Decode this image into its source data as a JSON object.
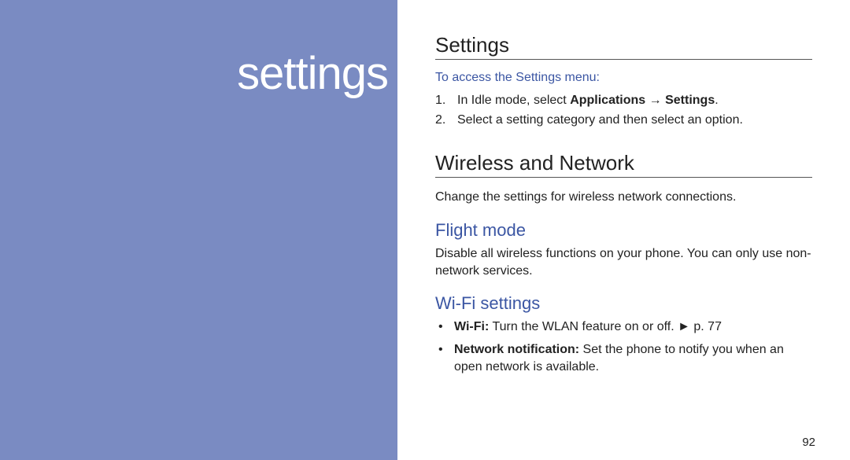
{
  "sidebar": {
    "title": "settings"
  },
  "settings": {
    "heading": "Settings",
    "access_intro": "To access the Settings menu:",
    "step1_pre": "In Idle mode, select ",
    "step1_app": "Applications",
    "step1_arrow": " → ",
    "step1_set": "Settings",
    "step1_post": ".",
    "step2": "Select a setting category and then select an option."
  },
  "wireless": {
    "heading": "Wireless and Network",
    "desc": "Change the settings for wireless network connections.",
    "flight": {
      "heading": "Flight mode",
      "desc": "Disable all wireless functions on your phone. You can only use non-network services."
    },
    "wifi": {
      "heading": "Wi-Fi settings",
      "item1_label": "Wi-Fi:",
      "item1_text": " Turn the WLAN feature on or off. ►  p. 77",
      "item2_label": "Network notification:",
      "item2_text": " Set the phone to notify you when an open network is available."
    }
  },
  "page_number": "92"
}
